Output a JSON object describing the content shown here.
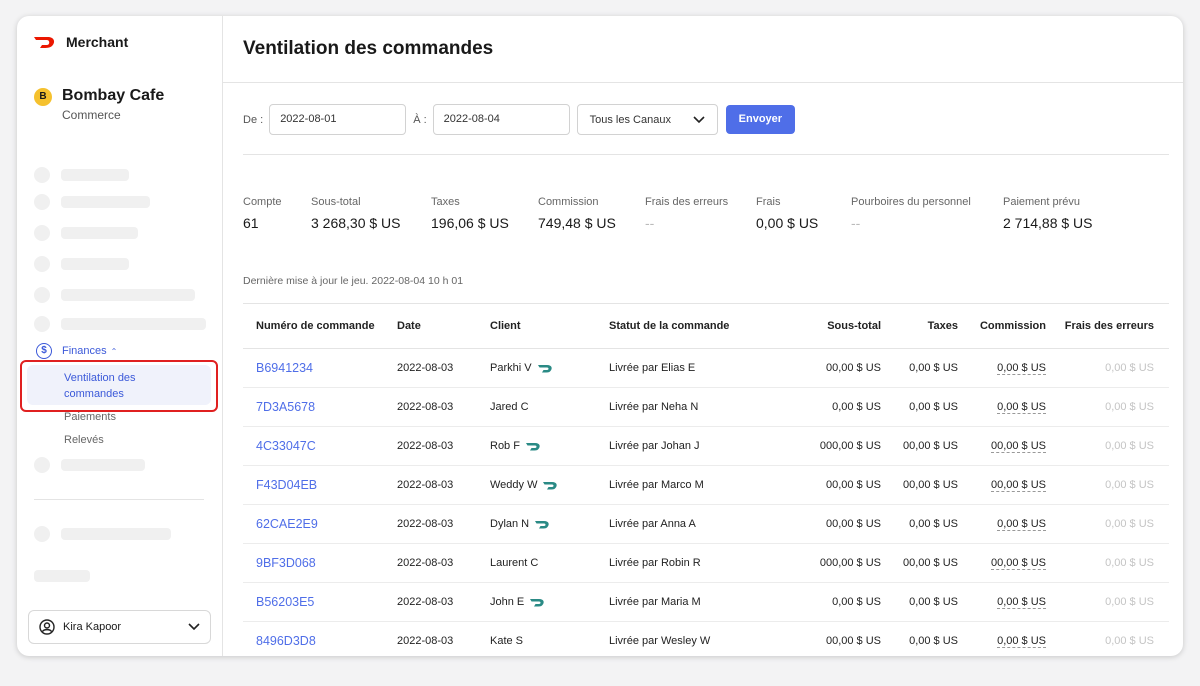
{
  "brand": {
    "name": "Merchant",
    "color": "#eb1700"
  },
  "store": {
    "initial": "B",
    "name": "Bombay Cafe",
    "subtitle": "Commerce"
  },
  "sidebar": {
    "finance_label": "Finances",
    "finance_icon": "dollar-icon",
    "active_item": "Ventilation des commandes",
    "sub_items": [
      "Paiements",
      "Relevés"
    ]
  },
  "user": {
    "name": "Kira Kapoor"
  },
  "header": {
    "title": "Ventilation des commandes"
  },
  "filters": {
    "from_label": "De :",
    "from_value": "2022-08-01",
    "to_label": "À :",
    "to_value": "2022-08-04",
    "channel_value": "Tous les Canaux",
    "submit_label": "Envoyer"
  },
  "stats": [
    {
      "label": "Compte",
      "value": "61"
    },
    {
      "label": "Sous-total",
      "value": "3 268,30 $ US"
    },
    {
      "label": "Taxes",
      "value": "196,06 $ US"
    },
    {
      "label": "Commission",
      "value": "749,48 $ US"
    },
    {
      "label": "Frais des erreurs",
      "value": "--"
    },
    {
      "label": "Frais",
      "value": "0,00 $ US"
    },
    {
      "label": "Pourboires du personnel",
      "value": "--"
    },
    {
      "label": "Paiement prévu",
      "value": "2 714,88 $ US"
    }
  ],
  "updated": "Dernière mise à jour le jeu. 2022-08-04 10 h 01",
  "table": {
    "columns": [
      "Numéro de commande",
      "Date",
      "Client",
      "Statut de la commande",
      "Sous-total",
      "Taxes",
      "Commission",
      "Frais des erreurs"
    ],
    "rows": [
      {
        "id": "B6941234",
        "date": "2022-08-03",
        "client": "Parkhi V",
        "dasher": true,
        "status": "Livrée par Elias E",
        "subtotal": "00,00 $ US",
        "taxes": "0,00 $ US",
        "commission": "0,00 $ US",
        "error_fees": "0,00 $ US"
      },
      {
        "id": "7D3A5678",
        "date": "2022-08-03",
        "client": "Jared C",
        "dasher": false,
        "status": "Livrée par Neha N",
        "subtotal": "0,00 $ US",
        "taxes": "0,00 $ US",
        "commission": "0,00 $ US",
        "error_fees": "0,00 $ US"
      },
      {
        "id": "4C33047C",
        "date": "2022-08-03",
        "client": "Rob F",
        "dasher": true,
        "status": "Livrée par Johan J",
        "subtotal": "000,00 $ US",
        "taxes": "00,00 $ US",
        "commission": "00,00 $ US",
        "error_fees": "0,00 $ US"
      },
      {
        "id": "F43D04EB",
        "date": "2022-08-03",
        "client": "Weddy W",
        "dasher": true,
        "status": "Livrée par Marco M",
        "subtotal": "00,00 $ US",
        "taxes": "00,00 $ US",
        "commission": "00,00 $ US",
        "error_fees": "0,00 $ US"
      },
      {
        "id": "62CAE2E9",
        "date": "2022-08-03",
        "client": "Dylan N",
        "dasher": true,
        "status": "Livrée par Anna A",
        "subtotal": "00,00 $ US",
        "taxes": "0,00 $ US",
        "commission": "0,00 $ US",
        "error_fees": "0,00 $ US"
      },
      {
        "id": "9BF3D068",
        "date": "2022-08-03",
        "client": "Laurent C",
        "dasher": false,
        "status": "Livrée par Robin R",
        "subtotal": "000,00 $ US",
        "taxes": "00,00 $ US",
        "commission": "00,00 $ US",
        "error_fees": "0,00 $ US"
      },
      {
        "id": "B56203E5",
        "date": "2022-08-03",
        "client": "John E",
        "dasher": true,
        "status": "Livrée par Maria M",
        "subtotal": "0,00 $ US",
        "taxes": "0,00 $ US",
        "commission": "0,00 $ US",
        "error_fees": "0,00 $ US"
      },
      {
        "id": "8496D3D8",
        "date": "2022-08-03",
        "client": "Kate S",
        "dasher": false,
        "status": "Livrée par Wesley W",
        "subtotal": "00,00 $ US",
        "taxes": "0,00 $ US",
        "commission": "0,00 $ US",
        "error_fees": "0,00 $ US"
      }
    ]
  }
}
